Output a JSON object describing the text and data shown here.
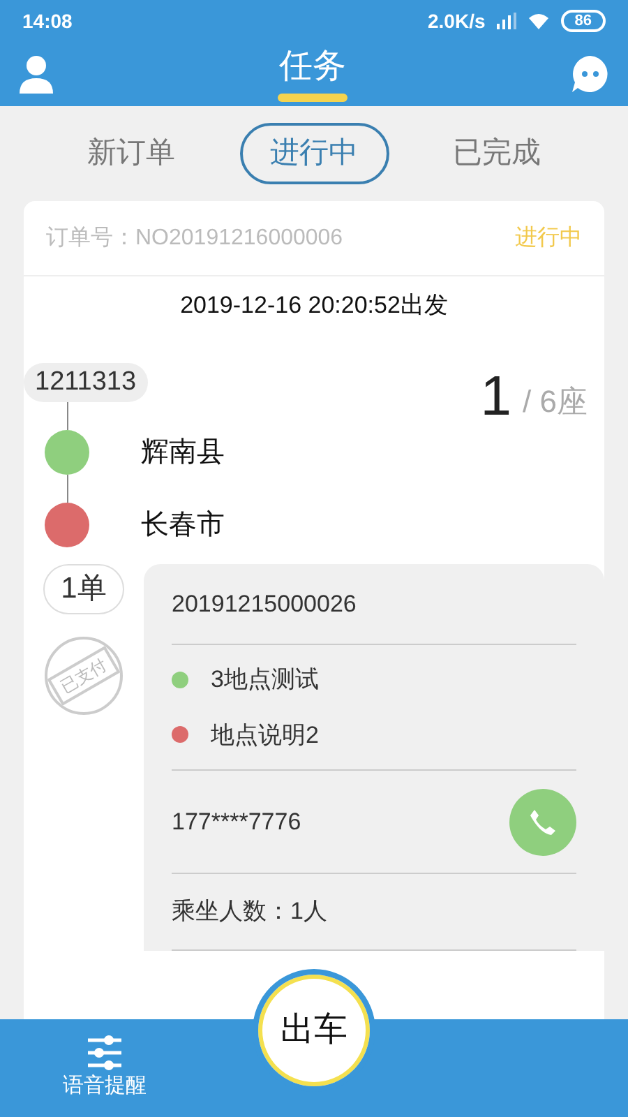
{
  "status_bar": {
    "time": "14:08",
    "speed": "2.0K/s",
    "battery": "86"
  },
  "header": {
    "title": "任务"
  },
  "tabs": [
    {
      "label": "新订单",
      "selected": false
    },
    {
      "label": "进行中",
      "selected": true
    },
    {
      "label": "已完成",
      "selected": false
    }
  ],
  "order": {
    "number_label": "订单号：NO20191216000006",
    "status": "进行中",
    "departure": "2019-12-16 20:20:52出发",
    "route_code": "1211313",
    "seats_taken": "1",
    "seats_total": "/ 6座",
    "stops": [
      {
        "name": "辉南县",
        "color": "#8fcf7e"
      },
      {
        "name": "长春市",
        "color": "#dc6b6b"
      }
    ],
    "count": "1单",
    "stamp": "已支付",
    "sub_order": {
      "number": "20191215000026",
      "places": [
        {
          "name": "3地点测试",
          "color": "#8fcf7e"
        },
        {
          "name": "地点说明2",
          "color": "#dc6b6b"
        }
      ],
      "phone": "177****7776",
      "passengers": "乘坐人数：1人"
    }
  },
  "bottom_bar": {
    "voice_label": "语音提醒",
    "action": "出车"
  }
}
